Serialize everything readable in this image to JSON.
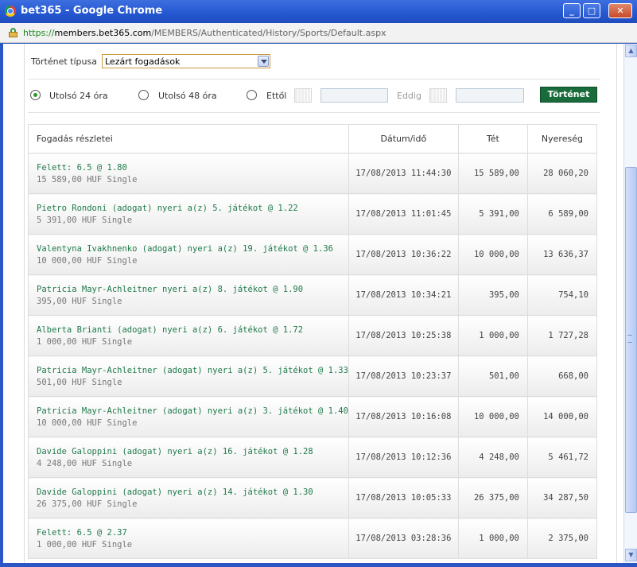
{
  "window": {
    "title": "bet365 - Google Chrome",
    "controls": {
      "minimize": "_",
      "maximize": "□",
      "close": "✕"
    }
  },
  "address": {
    "scheme": "https://",
    "host": "members.bet365.com",
    "path": "/MEMBERS/Authenticated/History/Sports/Default.aspx"
  },
  "filters": {
    "type_label": "Történet típusa",
    "type_selected": "Lezárt fogadások",
    "radio_24h": "Utolsó 24 óra",
    "radio_48h": "Utolsó 48 óra",
    "from_label": "Ettől",
    "to_label": "Eddig",
    "history_button": "Történet"
  },
  "table": {
    "headers": {
      "details": "Fogadás részletei",
      "datetime": "Dátum/idő",
      "stake": "Tét",
      "winnings": "Nyereség"
    },
    "rows": [
      {
        "selection": "Felett:  6.5 @ 1.80",
        "sub": "15 589,00 HUF  Single",
        "datetime": "17/08/2013 11:44:30",
        "stake": "15 589,00",
        "winnings": "28 060,20"
      },
      {
        "selection": "Pietro Rondoni (adogat) nyeri a(z) 5. játékot @ 1.22",
        "sub": "5 391,00 HUF  Single",
        "datetime": "17/08/2013 11:01:45",
        "stake": "5 391,00",
        "winnings": "6 589,00"
      },
      {
        "selection": "Valentyna Ivakhnenko (adogat) nyeri a(z) 19. játékot @ 1.36",
        "sub": "10 000,00 HUF  Single",
        "datetime": "17/08/2013 10:36:22",
        "stake": "10 000,00",
        "winnings": "13 636,37"
      },
      {
        "selection": "Patricia Mayr-Achleitner nyeri a(z) 8. játékot @ 1.90",
        "sub": "395,00 HUF  Single",
        "datetime": "17/08/2013 10:34:21",
        "stake": "395,00",
        "winnings": "754,10"
      },
      {
        "selection": "Alberta Brianti (adogat) nyeri a(z) 6. játékot @ 1.72",
        "sub": "1 000,00 HUF  Single",
        "datetime": "17/08/2013 10:25:38",
        "stake": "1 000,00",
        "winnings": "1 727,28"
      },
      {
        "selection": "Patricia Mayr-Achleitner (adogat) nyeri a(z) 5. játékot @ 1.33",
        "sub": "501,00 HUF  Single",
        "datetime": "17/08/2013 10:23:37",
        "stake": "501,00",
        "winnings": "668,00"
      },
      {
        "selection": "Patricia Mayr-Achleitner (adogat) nyeri a(z) 3. játékot @ 1.40",
        "sub": "10 000,00 HUF  Single",
        "datetime": "17/08/2013 10:16:08",
        "stake": "10 000,00",
        "winnings": "14 000,00"
      },
      {
        "selection": "Davide Galoppini (adogat) nyeri a(z) 16. játékot @ 1.28",
        "sub": "4 248,00 HUF  Single",
        "datetime": "17/08/2013 10:12:36",
        "stake": "4 248,00",
        "winnings": "5 461,72"
      },
      {
        "selection": "Davide Galoppini (adogat) nyeri a(z) 14. játékot @ 1.30",
        "sub": "26 375,00 HUF  Single",
        "datetime": "17/08/2013 10:05:33",
        "stake": "26 375,00",
        "winnings": "34 287,50"
      },
      {
        "selection": "Felett:  6.5 @ 2.37",
        "sub": "1 000,00 HUF  Single",
        "datetime": "17/08/2013 03:28:36",
        "stake": "1 000,00",
        "winnings": "2 375,00"
      }
    ]
  }
}
